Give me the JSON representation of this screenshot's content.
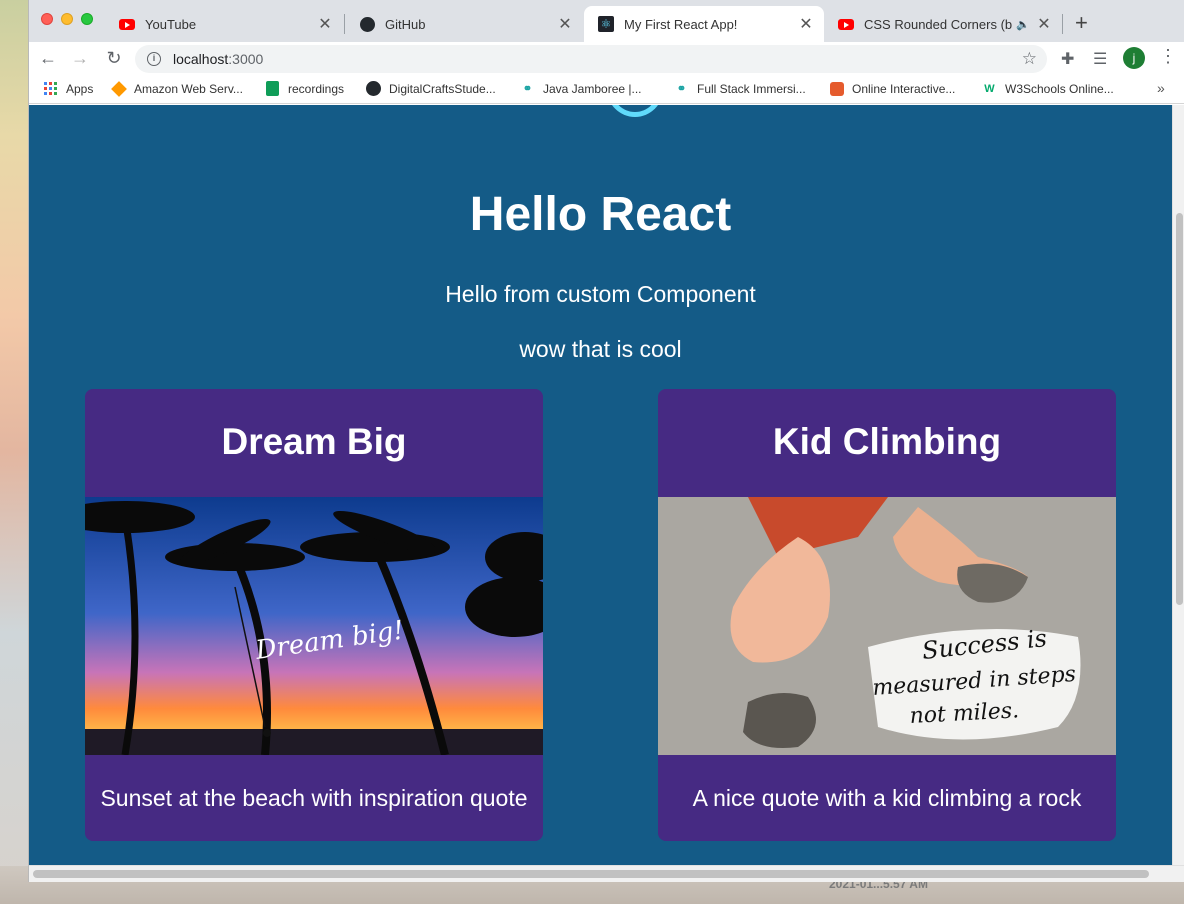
{
  "tabs": [
    {
      "title": "YouTube",
      "icon": "youtube-icon"
    },
    {
      "title": "GitHub",
      "icon": "github-icon"
    },
    {
      "title": "My First React App!",
      "icon": "react-icon",
      "active": true
    },
    {
      "title": "CSS Rounded Corners (bo",
      "icon": "youtube-icon",
      "audio": true
    }
  ],
  "toolbar": {
    "url_host": "localhost",
    "url_port": ":3000",
    "avatar_letter": "j"
  },
  "bookmarks": [
    {
      "label": "Apps",
      "icon": "apps-grid-icon"
    },
    {
      "label": "Amazon Web Serv...",
      "icon": "aws-icon"
    },
    {
      "label": "recordings",
      "icon": "sheets-icon"
    },
    {
      "label": "DigitalCraftsStude...",
      "icon": "github-icon"
    },
    {
      "label": "Java Jamboree |...",
      "icon": "link-icon"
    },
    {
      "label": "Full Stack Immersi...",
      "icon": "link-icon"
    },
    {
      "label": "Online Interactive...",
      "icon": "gift-icon"
    },
    {
      "label": "W3Schools Online...",
      "icon": "w3schools-icon"
    }
  ],
  "page": {
    "title": "Hello React",
    "line1": "Hello from custom Component",
    "line2": "wow that is cool",
    "cards": [
      {
        "title": "Dream Big",
        "image_text": "Dream big!",
        "caption": "Sunset at the beach with inspiration quote"
      },
      {
        "title": "Kid Climbing",
        "image_text_1": "Success is",
        "image_text_2": "measured in steps",
        "image_text_3": "not miles.",
        "caption": "A nice quote with a kid climbing a rock"
      }
    ]
  },
  "desktop": {
    "caption": "2021-01...5.57 AM"
  },
  "colors": {
    "page_bg": "#145b87",
    "card_bg": "#462a83",
    "react_accent": "#61dafb"
  }
}
